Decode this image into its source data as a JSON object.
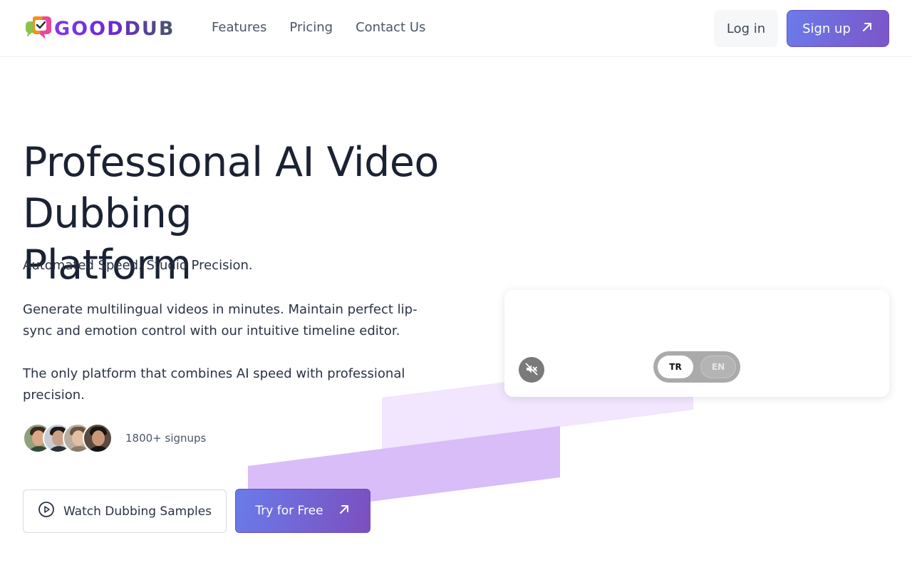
{
  "brand": {
    "name": "GOODDUB"
  },
  "nav": {
    "items": [
      {
        "label": "Features"
      },
      {
        "label": "Pricing"
      },
      {
        "label": "Contact Us"
      }
    ]
  },
  "auth": {
    "login_label": "Log in",
    "signup_label": "Sign up"
  },
  "hero": {
    "title_line1": "Professional AI Video Dubbing",
    "title_line2": "Platform",
    "tagline": "Automated Speed. Studio Precision.",
    "paragraph1": "Generate multilingual videos in minutes. Maintain perfect lip-sync and emotion control with our intuitive timeline editor.",
    "paragraph2": "The only platform that combines AI speed with professional precision.",
    "signups": "1800+ signups",
    "watch_label": "Watch Dubbing Samples",
    "try_label": "Try for Free"
  },
  "player": {
    "languages": [
      {
        "code": "TR",
        "active": true
      },
      {
        "code": "EN",
        "active": false
      }
    ],
    "muted": true
  },
  "colors": {
    "accent_start": "#6a7bea",
    "accent_end": "#7c4fbf",
    "deco_light": "#f1e6fd",
    "deco_mid": "#d8bdf8"
  },
  "icons": {
    "signup_arrow": "arrow-up-right-icon",
    "watch": "play-circle-icon",
    "try_arrow": "arrow-up-right-icon",
    "mute": "speaker-muted-icon",
    "logo": "chat-bubble-check-icon"
  }
}
